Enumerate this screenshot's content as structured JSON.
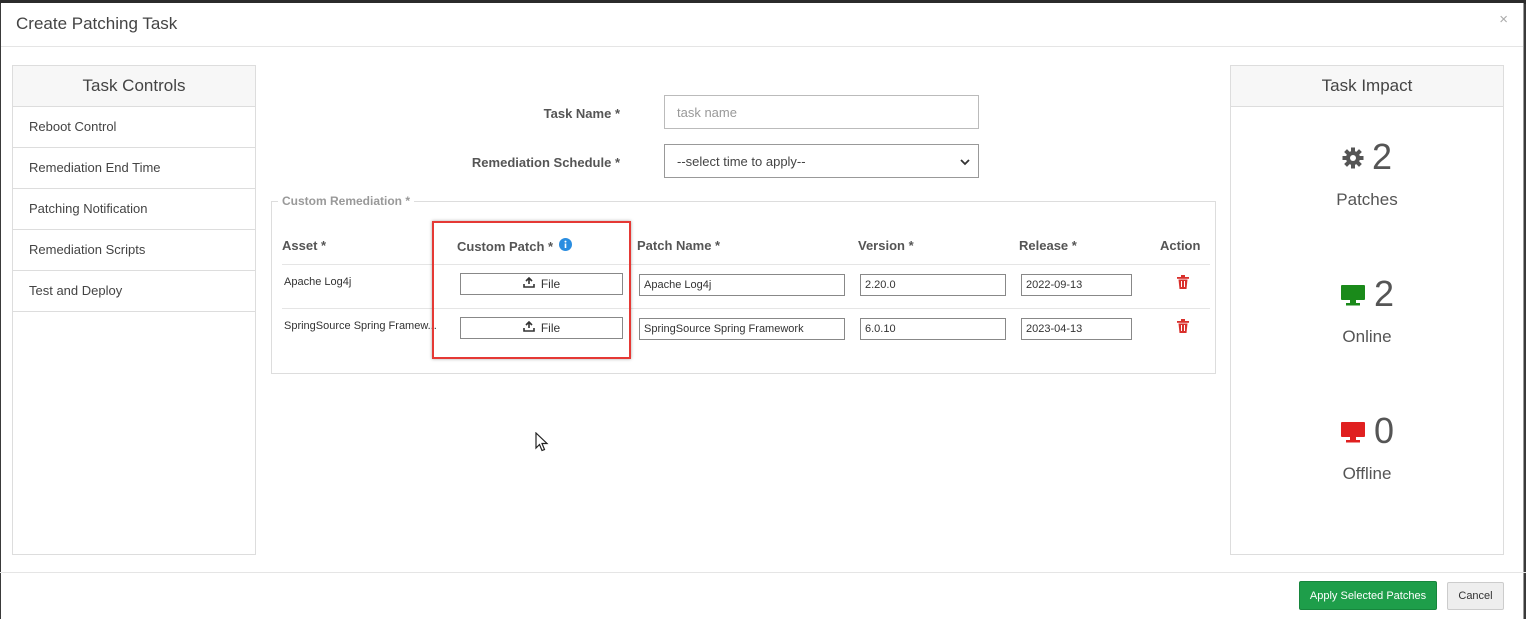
{
  "modal": {
    "title": "Create Patching Task",
    "close_label": "×"
  },
  "task_controls": {
    "heading": "Task Controls",
    "items": [
      {
        "label": "Reboot Control"
      },
      {
        "label": "Remediation End Time"
      },
      {
        "label": "Patching Notification"
      },
      {
        "label": "Remediation Scripts"
      },
      {
        "label": "Test and Deploy"
      }
    ]
  },
  "form": {
    "task_name_label": "Task Name *",
    "task_name_placeholder": "task name",
    "task_name_value": "",
    "schedule_label": "Remediation Schedule *",
    "schedule_value": "--select time to apply--"
  },
  "custom_remediation": {
    "legend": "Custom Remediation *",
    "headers": {
      "asset": "Asset *",
      "custom_patch": "Custom Patch *",
      "patch_name": "Patch Name *",
      "version": "Version *",
      "release": "Release *",
      "action": "Action"
    },
    "file_button_label": "File",
    "rows": [
      {
        "asset": "Apache Log4j",
        "patch_name": "Apache Log4j",
        "version": "2.20.0",
        "release": "2022-09-13"
      },
      {
        "asset": "SpringSource Spring Framew...",
        "patch_name": "SpringSource Spring Framework",
        "version": "6.0.10",
        "release": "2023-04-13"
      }
    ]
  },
  "task_impact": {
    "heading": "Task Impact",
    "patches": {
      "count": "2",
      "label": "Patches",
      "icon": "gear-icon",
      "color": "#555555"
    },
    "online": {
      "count": "2",
      "label": "Online",
      "icon": "monitor-icon",
      "color": "#1a8a1a"
    },
    "offline": {
      "count": "0",
      "label": "Offline",
      "icon": "monitor-icon",
      "color": "#e02020"
    }
  },
  "footer": {
    "apply_label": "Apply Selected Patches",
    "cancel_label": "Cancel"
  },
  "colors": {
    "accent_green": "#1e9e4a",
    "highlight_red": "#e53935",
    "delete_red": "#d9302c",
    "info_blue": "#2a8de0"
  }
}
